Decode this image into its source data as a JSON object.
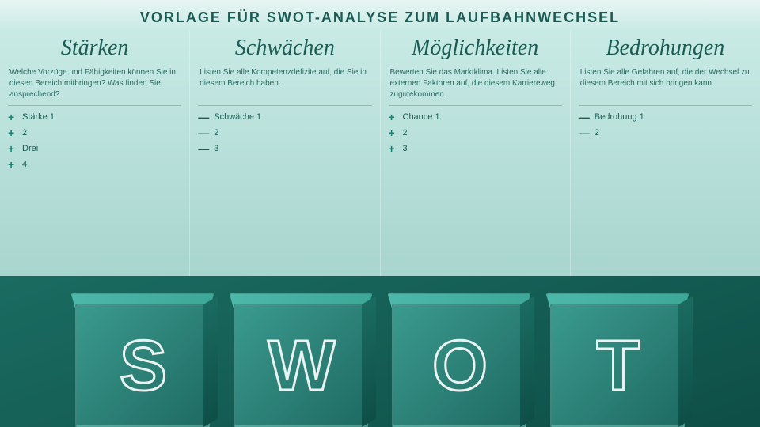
{
  "title": "VORLAGE FÜR SWOT-ANALYSE ZUM LAUFBAHNWECHSEL",
  "columns": [
    {
      "id": "staerken",
      "header": "Stärken",
      "description": "Welche Vorzüge und Fähigkeiten können Sie in diesen Bereich mitbringen? Was finden Sie ansprechend?",
      "items": [
        {
          "symbol": "+",
          "text": "Stärke 1"
        },
        {
          "symbol": "+",
          "text": "2"
        },
        {
          "symbol": "+",
          "text": "Drei"
        },
        {
          "symbol": "+",
          "text": "4"
        }
      ]
    },
    {
      "id": "schwaechen",
      "header": "Schwächen",
      "description": "Listen Sie alle Kompetenzdefizite auf, die Sie in diesem Bereich haben.",
      "items": [
        {
          "symbol": "—",
          "text": "Schwäche 1"
        },
        {
          "symbol": "—",
          "text": "2"
        },
        {
          "symbol": "—",
          "text": "3"
        }
      ]
    },
    {
      "id": "moeglichkeiten",
      "header": "Möglichkeiten",
      "description": "Bewerten Sie das Marktklima. Listen Sie alle externen Faktoren auf, die diesem Karriereweg zugutekommen.",
      "items": [
        {
          "symbol": "+",
          "text": "Chance 1"
        },
        {
          "symbol": "+",
          "text": "2"
        },
        {
          "symbol": "+",
          "text": "3"
        }
      ]
    },
    {
      "id": "bedrohungen",
      "header": "Bedrohungen",
      "description": "Listen Sie alle Gefahren auf, die der Wechsel zu diesem Bereich mit sich bringen kann.",
      "items": [
        {
          "symbol": "—",
          "text": "Bedrohung 1"
        },
        {
          "symbol": "—",
          "text": "2"
        }
      ]
    }
  ],
  "cubes": [
    {
      "letter": "S"
    },
    {
      "letter": "W"
    },
    {
      "letter": "O"
    },
    {
      "letter": "T"
    }
  ]
}
